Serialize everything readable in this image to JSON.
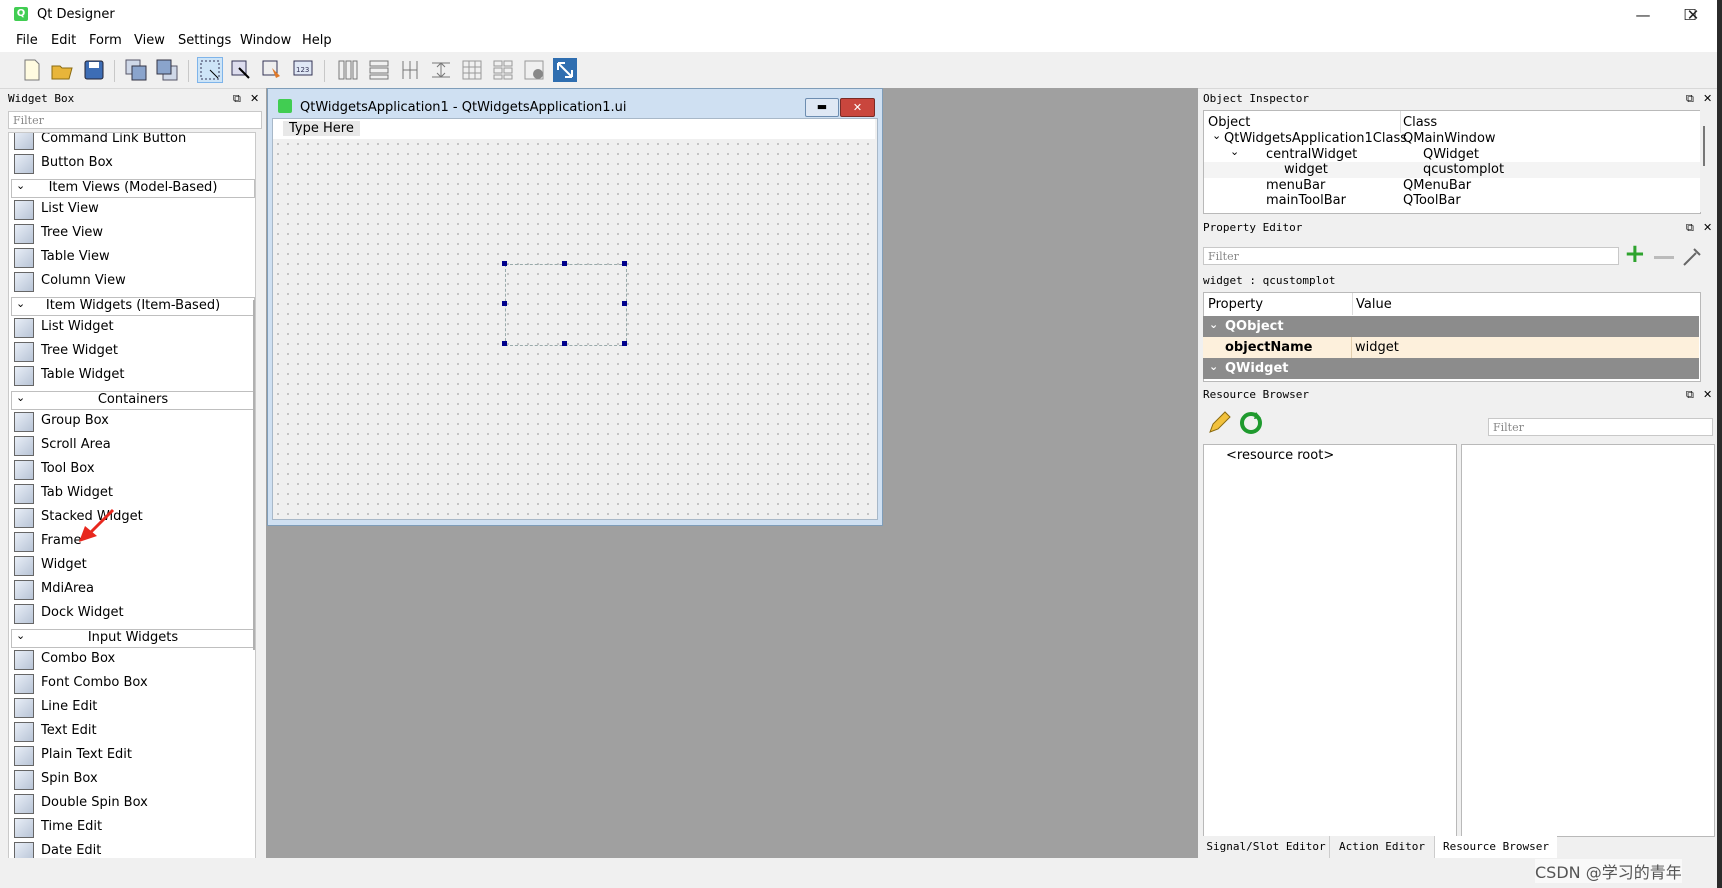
{
  "window": {
    "title": "Qt Designer",
    "app_icon": "Q",
    "controls": {
      "minimize": "—",
      "maximize": "☐",
      "close": "✕"
    }
  },
  "menubar": [
    "File",
    "Edit",
    "Form",
    "View",
    "Settings",
    "Window",
    "Help"
  ],
  "toolbar_icons": [
    "new-form-icon",
    "open-form-icon",
    "save-form-icon",
    "bring-to-front-icon",
    "send-to-back-icon",
    "edit-widgets-icon",
    "edit-signals-slots-icon",
    "edit-buddies-icon",
    "edit-tab-order-icon",
    "lay-out-horizontally-icon",
    "lay-out-vertically-icon",
    "lay-out-horizontal-splitter-icon",
    "lay-out-vertical-splitter-icon",
    "lay-out-grid-icon",
    "lay-out-form-icon",
    "break-layout-icon",
    "adjust-size-icon"
  ],
  "widget_box": {
    "title": "Widget Box",
    "filter_placeholder": "Filter",
    "entries": [
      {
        "kind": "item",
        "label": "Command Link Button",
        "icon": "command-link-icon"
      },
      {
        "kind": "item",
        "label": "Button Box",
        "icon": "button-box-icon"
      },
      {
        "kind": "cat",
        "label": "Item Views (Model-Based)"
      },
      {
        "kind": "item",
        "label": "List View",
        "icon": "list-view-icon"
      },
      {
        "kind": "item",
        "label": "Tree View",
        "icon": "tree-view-icon"
      },
      {
        "kind": "item",
        "label": "Table View",
        "icon": "table-view-icon"
      },
      {
        "kind": "item",
        "label": "Column View",
        "icon": "column-view-icon"
      },
      {
        "kind": "cat",
        "label": "Item Widgets (Item-Based)"
      },
      {
        "kind": "item",
        "label": "List Widget",
        "icon": "list-widget-icon"
      },
      {
        "kind": "item",
        "label": "Tree Widget",
        "icon": "tree-widget-icon"
      },
      {
        "kind": "item",
        "label": "Table Widget",
        "icon": "table-widget-icon"
      },
      {
        "kind": "cat",
        "label": "Containers"
      },
      {
        "kind": "item",
        "label": "Group Box",
        "icon": "group-box-icon"
      },
      {
        "kind": "item",
        "label": "Scroll Area",
        "icon": "scroll-area-icon"
      },
      {
        "kind": "item",
        "label": "Tool Box",
        "icon": "tool-box-icon"
      },
      {
        "kind": "item",
        "label": "Tab Widget",
        "icon": "tab-widget-icon"
      },
      {
        "kind": "item",
        "label": "Stacked Widget",
        "icon": "stacked-widget-icon"
      },
      {
        "kind": "item",
        "label": "Frame",
        "icon": "frame-icon"
      },
      {
        "kind": "item",
        "label": "Widget",
        "icon": "widget-icon"
      },
      {
        "kind": "item",
        "label": "MdiArea",
        "icon": "mdi-area-icon"
      },
      {
        "kind": "item",
        "label": "Dock Widget",
        "icon": "dock-widget-icon"
      },
      {
        "kind": "cat",
        "label": "Input Widgets"
      },
      {
        "kind": "item",
        "label": "Combo Box",
        "icon": "combo-box-icon"
      },
      {
        "kind": "item",
        "label": "Font Combo Box",
        "icon": "font-combo-box-icon"
      },
      {
        "kind": "item",
        "label": "Line Edit",
        "icon": "line-edit-icon"
      },
      {
        "kind": "item",
        "label": "Text Edit",
        "icon": "text-edit-icon"
      },
      {
        "kind": "item",
        "label": "Plain Text Edit",
        "icon": "plain-text-edit-icon"
      },
      {
        "kind": "item",
        "label": "Spin Box",
        "icon": "spin-box-icon"
      },
      {
        "kind": "item",
        "label": "Double Spin Box",
        "icon": "double-spin-box-icon"
      },
      {
        "kind": "item",
        "label": "Time Edit",
        "icon": "time-edit-icon"
      },
      {
        "kind": "item",
        "label": "Date Edit",
        "icon": "date-edit-icon"
      }
    ]
  },
  "form": {
    "title": "QtWidgetsApplication1 - QtWidgetsApplication1.ui",
    "menu_placeholder": "Type Here"
  },
  "object_inspector": {
    "title": "Object Inspector",
    "col_object": "Object",
    "col_class": "Class",
    "rows": [
      {
        "object": "QtWidgetsApplication1Class",
        "class": "QMainWindow",
        "depth": 0,
        "expander": "v"
      },
      {
        "object": "centralWidget",
        "class": "QWidget",
        "depth": 1,
        "expander": "v"
      },
      {
        "object": "widget",
        "class": "qcustomplot",
        "depth": 2,
        "expander": ""
      },
      {
        "object": "menuBar",
        "class": "QMenuBar",
        "depth": 1,
        "expander": ""
      },
      {
        "object": "mainToolBar",
        "class": "QToolBar",
        "depth": 1,
        "expander": ""
      }
    ]
  },
  "property_editor": {
    "title": "Property Editor",
    "filter_placeholder": "Filter",
    "context": "widget : qcustomplot",
    "col_property": "Property",
    "col_value": "Value",
    "group1": "QObject",
    "row_name": "objectName",
    "row_value": "widget",
    "group2": "QWidget"
  },
  "resource_browser": {
    "title": "Resource Browser",
    "filter_placeholder": "Filter",
    "root": "<resource root>"
  },
  "bottom_tabs": [
    "Signal/Slot Editor",
    "Action Editor",
    "Resource Browser"
  ],
  "watermark": "CSDN @学习的青年",
  "colors": {
    "selection_row": "#fdf0dc",
    "group_header": "#8c8c8c",
    "annotation_arrow": "#e8281e",
    "handle": "#00008b"
  }
}
